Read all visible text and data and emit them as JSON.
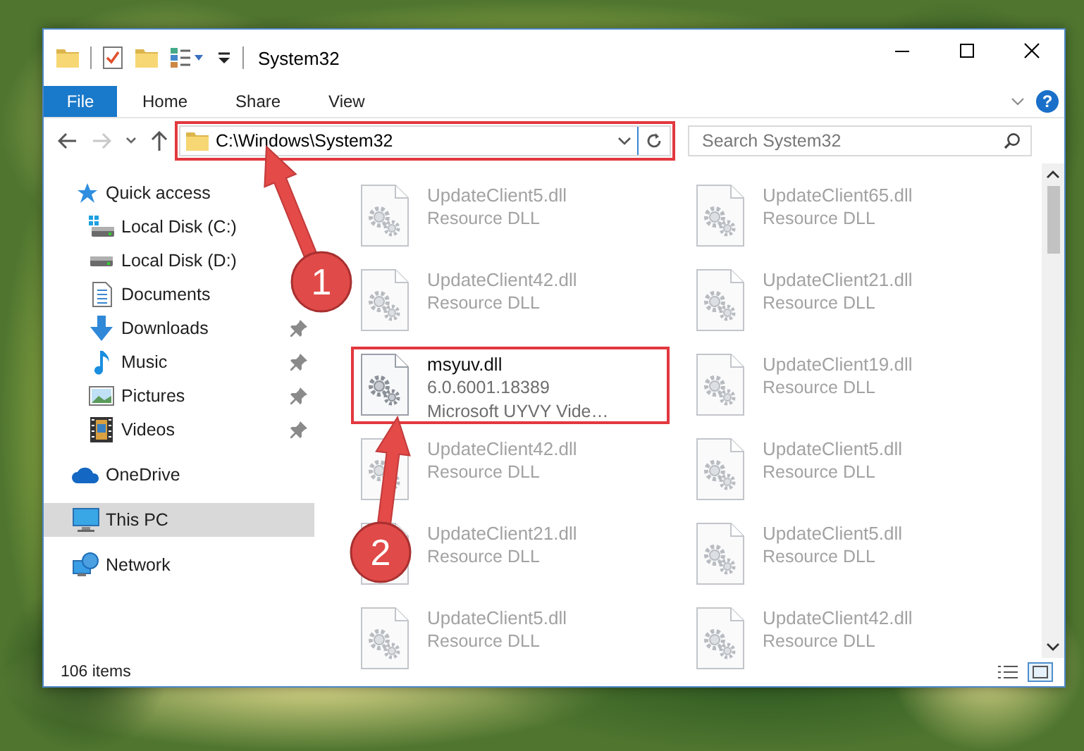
{
  "window": {
    "title": "System32"
  },
  "ribbon": {
    "tabs": [
      {
        "label": "File",
        "kind": "file"
      },
      {
        "label": "Home",
        "kind": "tab"
      },
      {
        "label": "Share",
        "kind": "tab"
      },
      {
        "label": "View",
        "kind": "tab"
      }
    ],
    "help": "?"
  },
  "navigation": {
    "back_enabled": true,
    "forward_enabled": false
  },
  "address_bar": {
    "path": "C:\\Windows\\System32",
    "highlighted": true
  },
  "search": {
    "placeholder": "Search System32"
  },
  "sidebar": {
    "items": [
      {
        "label": "Quick access",
        "kind": "star",
        "selected": false,
        "children": [
          {
            "label": "Local Disk (C:)",
            "kind": "system-drive",
            "pinned": false,
            "selected": false
          },
          {
            "label": "Local Disk (D:)",
            "kind": "drive",
            "pinned": false,
            "selected": false
          },
          {
            "label": "Documents",
            "kind": "documents",
            "pinned": false,
            "selected": false
          },
          {
            "label": "Downloads",
            "kind": "downloads",
            "pinned": true,
            "selected": false
          },
          {
            "label": "Music",
            "kind": "music",
            "pinned": true,
            "selected": false
          },
          {
            "label": "Pictures",
            "kind": "pictures",
            "pinned": true,
            "selected": false
          },
          {
            "label": "Videos",
            "kind": "videos",
            "pinned": true,
            "selected": false
          }
        ]
      },
      {
        "label": "OneDrive",
        "kind": "cloud",
        "selected": false
      },
      {
        "label": "This PC",
        "kind": "pc",
        "selected": true
      },
      {
        "label": "Network",
        "kind": "network",
        "selected": false
      }
    ]
  },
  "files": [
    {
      "name": "UpdateClient5.dll",
      "details": [
        "Resource DLL"
      ],
      "blurred": true,
      "highlighted": false
    },
    {
      "name": "UpdateClient65.dll",
      "details": [
        "Resource DLL"
      ],
      "blurred": true,
      "highlighted": false
    },
    {
      "name": "UpdateClient42.dll",
      "details": [
        "Resource DLL"
      ],
      "blurred": true,
      "highlighted": false
    },
    {
      "name": "UpdateClient21.dll",
      "details": [
        "Resource DLL"
      ],
      "blurred": true,
      "highlighted": false
    },
    {
      "name": "msyuv.dll",
      "details": [
        "6.0.6001.18389",
        "Microsoft UYVY Vide…"
      ],
      "blurred": false,
      "highlighted": true
    },
    {
      "name": "UpdateClient19.dll",
      "details": [
        "Resource DLL"
      ],
      "blurred": true,
      "highlighted": false
    },
    {
      "name": "UpdateClient42.dll",
      "details": [
        "Resource DLL"
      ],
      "blurred": true,
      "highlighted": false
    },
    {
      "name": "UpdateClient5.dll",
      "details": [
        "Resource DLL"
      ],
      "blurred": true,
      "highlighted": false
    },
    {
      "name": "UpdateClient21.dll",
      "details": [
        "Resource DLL"
      ],
      "blurred": true,
      "highlighted": false
    },
    {
      "name": "UpdateClient5.dll",
      "details": [
        "Resource DLL"
      ],
      "blurred": true,
      "highlighted": false
    },
    {
      "name": "UpdateClient5.dll",
      "details": [
        "Resource DLL"
      ],
      "blurred": true,
      "highlighted": false
    },
    {
      "name": "UpdateClient42.dll",
      "details": [
        "Resource DLL"
      ],
      "blurred": true,
      "highlighted": false
    }
  ],
  "status_bar": {
    "item_count": "106 items"
  },
  "annotations": [
    {
      "label": "1"
    },
    {
      "label": "2"
    }
  ]
}
